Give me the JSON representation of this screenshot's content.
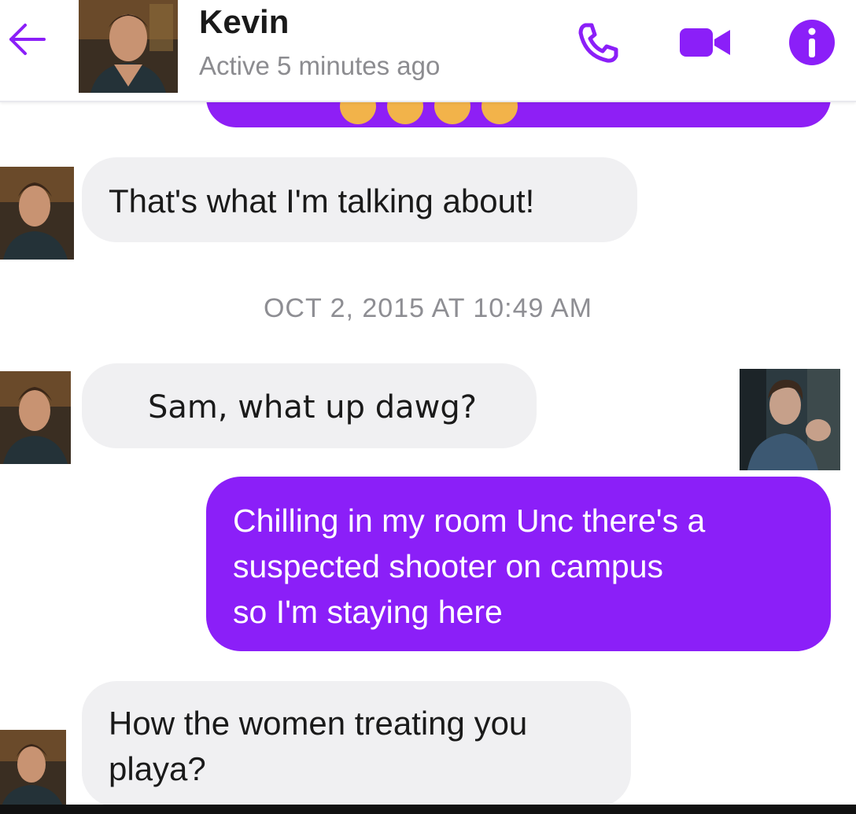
{
  "header": {
    "contact_name": "Kevin",
    "status": "Active 5 minutes ago",
    "icons": [
      "back-arrow-icon",
      "phone-icon",
      "video-camera-icon",
      "info-icon"
    ],
    "accent_color": "#8b1ff8"
  },
  "messages": [
    {
      "from": "Kevin",
      "lines": [
        "That's what I'm talking about!"
      ]
    },
    {
      "timestamp": "OCT 2, 2015 AT 10:49 AM"
    },
    {
      "from": "Kevin",
      "lines": [
        "Sam, what up dawg?"
      ]
    },
    {
      "from": "me",
      "lines": [
        "Chilling in my room Unc there's a",
        "suspected shooter on campus",
        "so I'm staying here"
      ]
    },
    {
      "from": "Kevin",
      "lines": [
        "How the women treating you",
        "playa?"
      ]
    }
  ],
  "colors": {
    "sent_bubble": "#8b1ff8",
    "received_bubble": "#f0f0f2",
    "timestamp_text": "#8e8e93"
  }
}
